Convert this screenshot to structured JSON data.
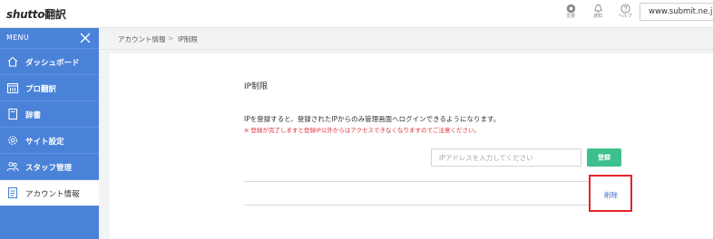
{
  "header": {
    "logo_text": "shutto",
    "logo_suffix": "翻訳",
    "icons": [
      {
        "name": "support",
        "label": "支援"
      },
      {
        "name": "notice",
        "label": "通知"
      },
      {
        "name": "help",
        "label": "ヘルプ"
      }
    ],
    "domain": "www.submit.ne.jp /"
  },
  "sidebar": {
    "menu_label": "MENU",
    "items": [
      {
        "label": "ダッシュボード",
        "icon": "home-icon",
        "active": false
      },
      {
        "label": "プロ翻訳",
        "icon": "calendar-icon",
        "active": false
      },
      {
        "label": "辞書",
        "icon": "book-icon",
        "active": false
      },
      {
        "label": "サイト設定",
        "icon": "gear-icon",
        "active": false
      },
      {
        "label": "スタッフ管理",
        "icon": "users-icon",
        "active": false
      },
      {
        "label": "アカウント情報",
        "icon": "document-icon",
        "active": true
      }
    ]
  },
  "breadcrumb": {
    "parent": "アカウント情報",
    "separator": ">",
    "current": "IP制限"
  },
  "main": {
    "title": "IP制限",
    "description": "IPを登録すると、登録されたIPからのみ管理画面へログインできるようになります。",
    "warning": "※ 登録が完了しますと登録IP以外からはアクセスできなくなりますのでご注意ください。",
    "ip_input": {
      "value": "",
      "placeholder": "IPアドレスを入力してください"
    },
    "register_label": "登録",
    "delete_label": "削除"
  },
  "colors": {
    "sidebar": "#4a82d8",
    "register_button": "#3cc08c",
    "warning_text": "#e0303a",
    "highlight_border": "#e8222a",
    "link": "#3a6fd0"
  }
}
